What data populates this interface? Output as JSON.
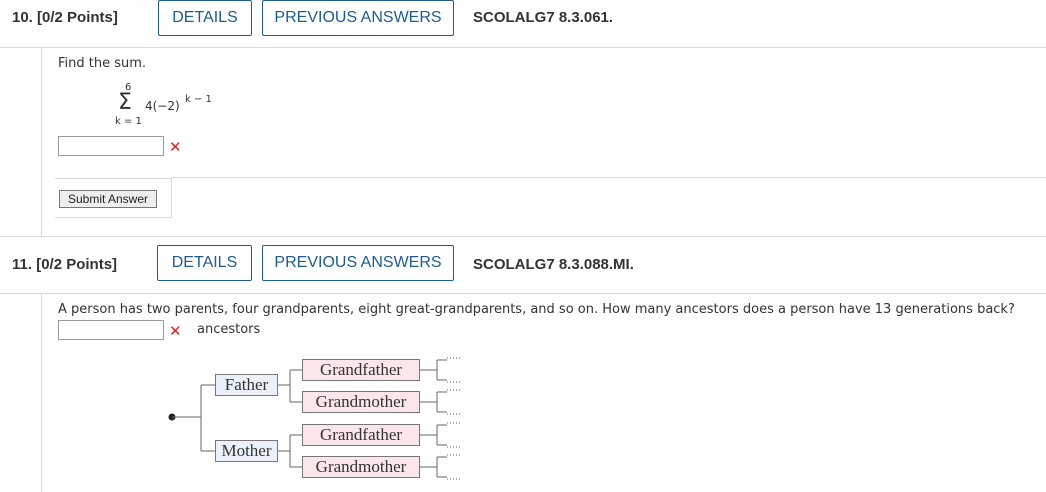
{
  "q10": {
    "number": "10.",
    "points": "[0/2 Points]",
    "details_label": "DETAILS",
    "previous_label": "PREVIOUS ANSWERS",
    "code": "SCOLALG7 8.3.061.",
    "prompt": "Find the sum.",
    "sum": {
      "upper": "6",
      "lower": "k = 1",
      "sigma": "Σ",
      "expression": "4(−2)",
      "exponent": "k − 1"
    },
    "answer_value": "",
    "result": "incorrect",
    "submit_label": "Submit Answer"
  },
  "q11": {
    "number": "11.",
    "points": "[0/2 Points]",
    "details_label": "DETAILS",
    "previous_label": "PREVIOUS ANSWERS",
    "code": "SCOLALG7 8.3.088.MI.",
    "prompt": "A person has two parents, four grandparents, eight great-grandparents, and so on. How many ancestors does a person have 13 generations back?",
    "answer_value": "",
    "answer_unit": "ancestors",
    "result": "incorrect",
    "tree": {
      "parents": [
        "Father",
        "Mother"
      ],
      "grandparents": [
        "Grandfather",
        "Grandmother",
        "Grandfather",
        "Grandmother"
      ]
    }
  },
  "colors": {
    "accent": "#1e5b8e",
    "error": "#dd2222",
    "parent_fill": "#eaf1fb",
    "grandparent_fill": "#fbe6ea"
  }
}
